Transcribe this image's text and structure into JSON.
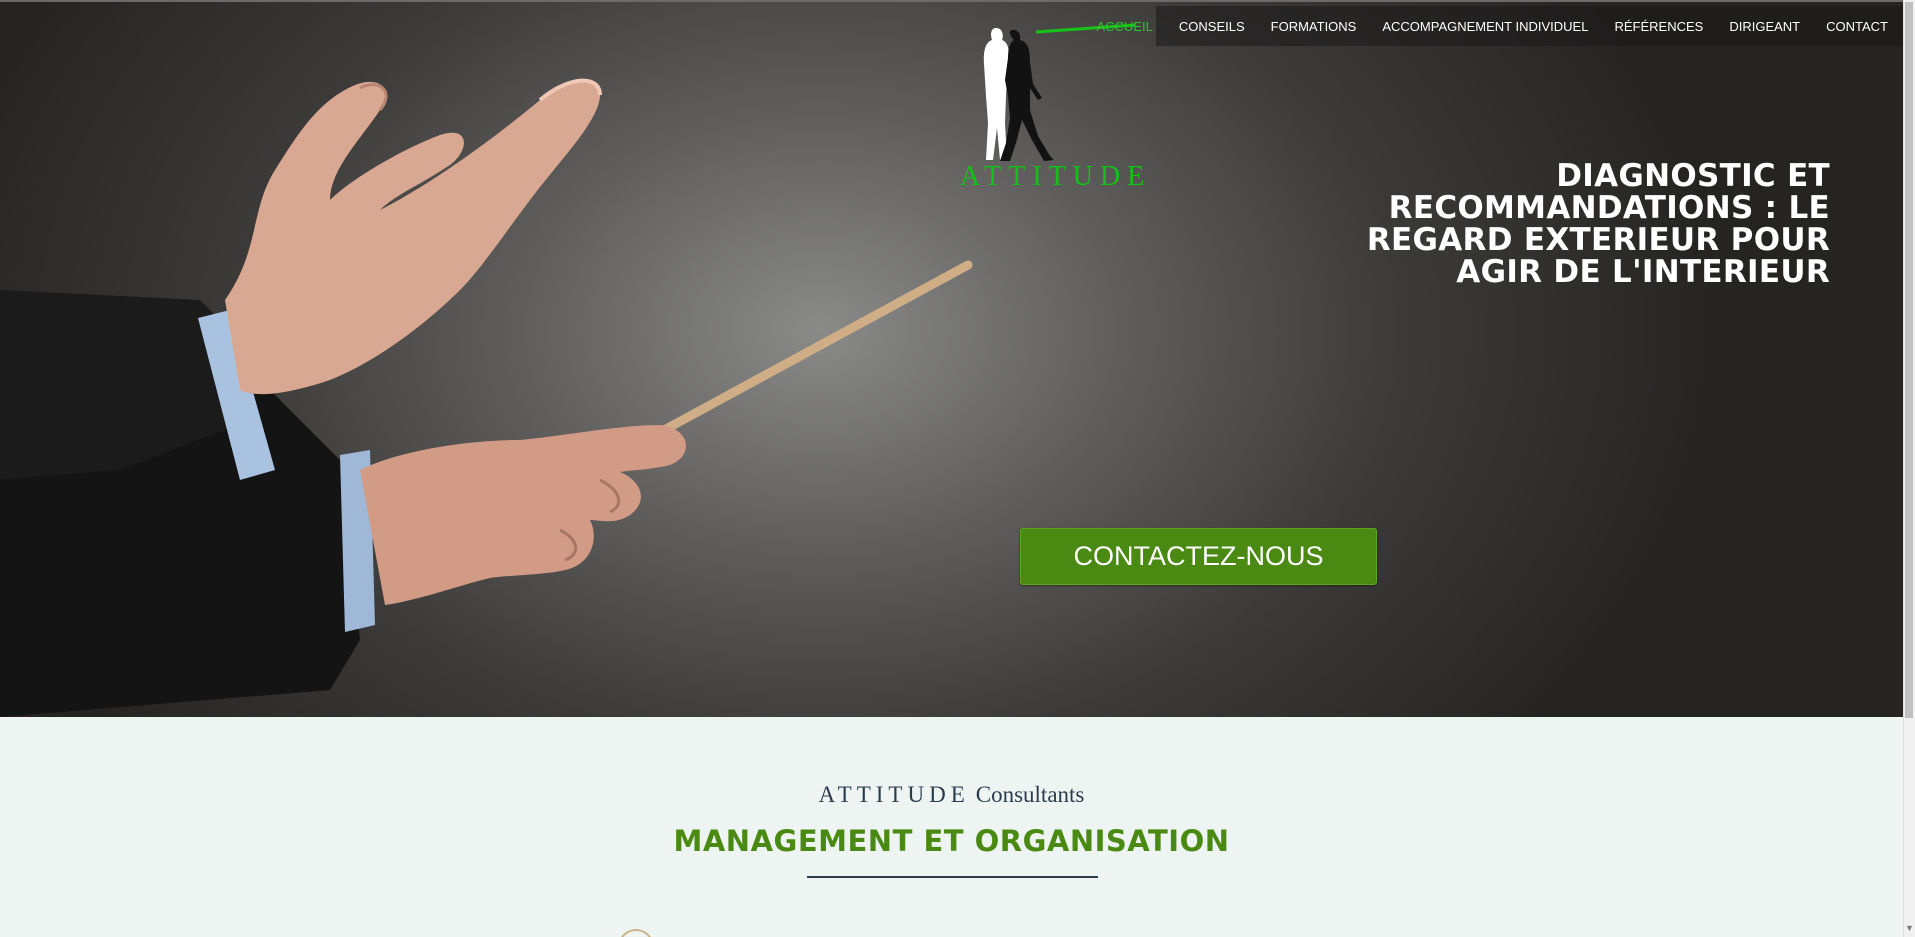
{
  "brand": {
    "logo_text": "ATTITUDE"
  },
  "nav": {
    "items": [
      {
        "label": "ACCUEIL",
        "active": true
      },
      {
        "label": "CONSEILS",
        "active": false
      },
      {
        "label": "FORMATIONS",
        "active": false
      },
      {
        "label": "ACCOMPAGNEMENT INDIVIDUEL",
        "active": false
      },
      {
        "label": "RÉFÉRENCES",
        "active": false
      },
      {
        "label": "DIRIGEANT",
        "active": false
      },
      {
        "label": "CONTACT",
        "active": false
      }
    ]
  },
  "hero": {
    "headline_lines": [
      "DIAGNOSTIC ET",
      "RECOMMANDATIONS : LE",
      "REGARD EXTERIEUR POUR",
      "AGIR DE L'INTERIEUR"
    ],
    "cta_label": "CONTACTEZ-NOUS",
    "image_icon": "conductor-hands-baton-photo"
  },
  "intro": {
    "brand_spaced": "ATTITUDE",
    "brand_suffix": "Consultants",
    "title": "MANAGEMENT ET ORGANISATION"
  },
  "colors": {
    "accent_green": "#4a8a12",
    "nav_active": "#2ec42e",
    "logo_green": "#13c313",
    "navy": "#2b3b4e",
    "section_bg": "#eef4f1"
  }
}
